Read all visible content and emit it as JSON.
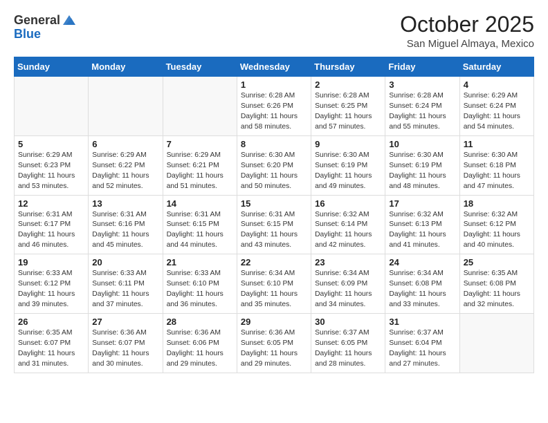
{
  "header": {
    "logo_general": "General",
    "logo_blue": "Blue",
    "month": "October 2025",
    "location": "San Miguel Almaya, Mexico"
  },
  "weekdays": [
    "Sunday",
    "Monday",
    "Tuesday",
    "Wednesday",
    "Thursday",
    "Friday",
    "Saturday"
  ],
  "weeks": [
    [
      {
        "day": "",
        "info": ""
      },
      {
        "day": "",
        "info": ""
      },
      {
        "day": "",
        "info": ""
      },
      {
        "day": "1",
        "info": "Sunrise: 6:28 AM\nSunset: 6:26 PM\nDaylight: 11 hours\nand 58 minutes."
      },
      {
        "day": "2",
        "info": "Sunrise: 6:28 AM\nSunset: 6:25 PM\nDaylight: 11 hours\nand 57 minutes."
      },
      {
        "day": "3",
        "info": "Sunrise: 6:28 AM\nSunset: 6:24 PM\nDaylight: 11 hours\nand 55 minutes."
      },
      {
        "day": "4",
        "info": "Sunrise: 6:29 AM\nSunset: 6:24 PM\nDaylight: 11 hours\nand 54 minutes."
      }
    ],
    [
      {
        "day": "5",
        "info": "Sunrise: 6:29 AM\nSunset: 6:23 PM\nDaylight: 11 hours\nand 53 minutes."
      },
      {
        "day": "6",
        "info": "Sunrise: 6:29 AM\nSunset: 6:22 PM\nDaylight: 11 hours\nand 52 minutes."
      },
      {
        "day": "7",
        "info": "Sunrise: 6:29 AM\nSunset: 6:21 PM\nDaylight: 11 hours\nand 51 minutes."
      },
      {
        "day": "8",
        "info": "Sunrise: 6:30 AM\nSunset: 6:20 PM\nDaylight: 11 hours\nand 50 minutes."
      },
      {
        "day": "9",
        "info": "Sunrise: 6:30 AM\nSunset: 6:19 PM\nDaylight: 11 hours\nand 49 minutes."
      },
      {
        "day": "10",
        "info": "Sunrise: 6:30 AM\nSunset: 6:19 PM\nDaylight: 11 hours\nand 48 minutes."
      },
      {
        "day": "11",
        "info": "Sunrise: 6:30 AM\nSunset: 6:18 PM\nDaylight: 11 hours\nand 47 minutes."
      }
    ],
    [
      {
        "day": "12",
        "info": "Sunrise: 6:31 AM\nSunset: 6:17 PM\nDaylight: 11 hours\nand 46 minutes."
      },
      {
        "day": "13",
        "info": "Sunrise: 6:31 AM\nSunset: 6:16 PM\nDaylight: 11 hours\nand 45 minutes."
      },
      {
        "day": "14",
        "info": "Sunrise: 6:31 AM\nSunset: 6:15 PM\nDaylight: 11 hours\nand 44 minutes."
      },
      {
        "day": "15",
        "info": "Sunrise: 6:31 AM\nSunset: 6:15 PM\nDaylight: 11 hours\nand 43 minutes."
      },
      {
        "day": "16",
        "info": "Sunrise: 6:32 AM\nSunset: 6:14 PM\nDaylight: 11 hours\nand 42 minutes."
      },
      {
        "day": "17",
        "info": "Sunrise: 6:32 AM\nSunset: 6:13 PM\nDaylight: 11 hours\nand 41 minutes."
      },
      {
        "day": "18",
        "info": "Sunrise: 6:32 AM\nSunset: 6:12 PM\nDaylight: 11 hours\nand 40 minutes."
      }
    ],
    [
      {
        "day": "19",
        "info": "Sunrise: 6:33 AM\nSunset: 6:12 PM\nDaylight: 11 hours\nand 39 minutes."
      },
      {
        "day": "20",
        "info": "Sunrise: 6:33 AM\nSunset: 6:11 PM\nDaylight: 11 hours\nand 37 minutes."
      },
      {
        "day": "21",
        "info": "Sunrise: 6:33 AM\nSunset: 6:10 PM\nDaylight: 11 hours\nand 36 minutes."
      },
      {
        "day": "22",
        "info": "Sunrise: 6:34 AM\nSunset: 6:10 PM\nDaylight: 11 hours\nand 35 minutes."
      },
      {
        "day": "23",
        "info": "Sunrise: 6:34 AM\nSunset: 6:09 PM\nDaylight: 11 hours\nand 34 minutes."
      },
      {
        "day": "24",
        "info": "Sunrise: 6:34 AM\nSunset: 6:08 PM\nDaylight: 11 hours\nand 33 minutes."
      },
      {
        "day": "25",
        "info": "Sunrise: 6:35 AM\nSunset: 6:08 PM\nDaylight: 11 hours\nand 32 minutes."
      }
    ],
    [
      {
        "day": "26",
        "info": "Sunrise: 6:35 AM\nSunset: 6:07 PM\nDaylight: 11 hours\nand 31 minutes."
      },
      {
        "day": "27",
        "info": "Sunrise: 6:36 AM\nSunset: 6:07 PM\nDaylight: 11 hours\nand 30 minutes."
      },
      {
        "day": "28",
        "info": "Sunrise: 6:36 AM\nSunset: 6:06 PM\nDaylight: 11 hours\nand 29 minutes."
      },
      {
        "day": "29",
        "info": "Sunrise: 6:36 AM\nSunset: 6:05 PM\nDaylight: 11 hours\nand 29 minutes."
      },
      {
        "day": "30",
        "info": "Sunrise: 6:37 AM\nSunset: 6:05 PM\nDaylight: 11 hours\nand 28 minutes."
      },
      {
        "day": "31",
        "info": "Sunrise: 6:37 AM\nSunset: 6:04 PM\nDaylight: 11 hours\nand 27 minutes."
      },
      {
        "day": "",
        "info": ""
      }
    ]
  ]
}
